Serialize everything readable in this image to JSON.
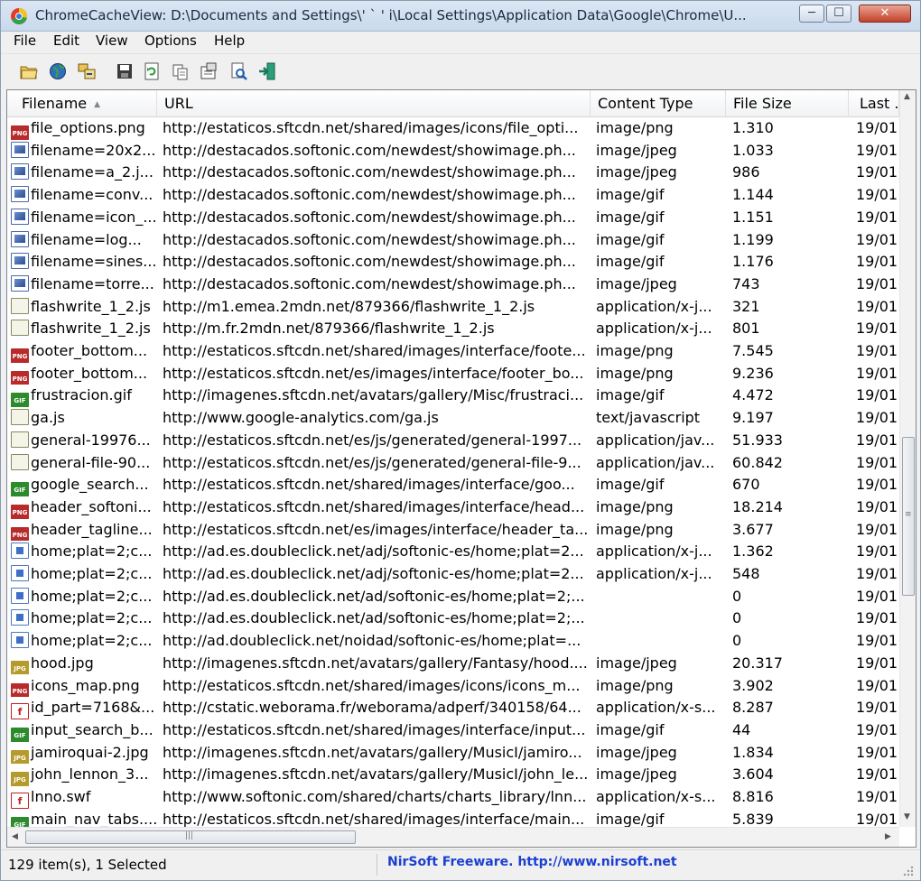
{
  "window": {
    "title": "ChromeCacheView:  D:\\Documents and Settings\\'   `  ' i\\Local Settings\\Application Data\\Google\\Chrome\\U...",
    "minimize_icon": "minimize-icon",
    "maximize_icon": "maximize-icon",
    "close_icon": "close-icon"
  },
  "menu": [
    "File",
    "Edit",
    "View",
    "Options",
    "Help"
  ],
  "toolbar": [
    {
      "name": "open-folder-icon"
    },
    {
      "name": "globe-icon"
    },
    {
      "name": "copy-files-icon"
    },
    {
      "name": "save-icon"
    },
    {
      "name": "refresh-icon"
    },
    {
      "name": "copy-icon"
    },
    {
      "name": "properties-icon"
    },
    {
      "name": "html-report-icon"
    },
    {
      "name": "exit-icon"
    }
  ],
  "columns": {
    "filename": "Filename",
    "url": "URL",
    "content_type": "Content Type",
    "file_size": "File Size",
    "last": "Last ."
  },
  "rows": [
    {
      "icon": "png",
      "filename": "file_options.png",
      "url": "http://estaticos.sftcdn.net/shared/images/icons/file_opti...",
      "type": "image/png",
      "size": "1.310",
      "last": "19/01"
    },
    {
      "icon": "img",
      "filename": "filename=20x2...",
      "url": "http://destacados.softonic.com/newdest/showimage.ph...",
      "type": "image/jpeg",
      "size": "1.033",
      "last": "19/01"
    },
    {
      "icon": "img",
      "filename": "filename=a_2.j...",
      "url": "http://destacados.softonic.com/newdest/showimage.ph...",
      "type": "image/jpeg",
      "size": "986",
      "last": "19/01"
    },
    {
      "icon": "img",
      "filename": "filename=conv...",
      "url": "http://destacados.softonic.com/newdest/showimage.ph...",
      "type": "image/gif",
      "size": "1.144",
      "last": "19/01"
    },
    {
      "icon": "img",
      "filename": "filename=icon_...",
      "url": "http://destacados.softonic.com/newdest/showimage.ph...",
      "type": "image/gif",
      "size": "1.151",
      "last": "19/01"
    },
    {
      "icon": "img",
      "filename": "filename=log...",
      "url": "http://destacados.softonic.com/newdest/showimage.ph...",
      "type": "image/gif",
      "size": "1.199",
      "last": "19/01"
    },
    {
      "icon": "img",
      "filename": "filename=sines...",
      "url": "http://destacados.softonic.com/newdest/showimage.ph...",
      "type": "image/gif",
      "size": "1.176",
      "last": "19/01"
    },
    {
      "icon": "img",
      "filename": "filename=torre...",
      "url": "http://destacados.softonic.com/newdest/showimage.ph...",
      "type": "image/jpeg",
      "size": "743",
      "last": "19/01"
    },
    {
      "icon": "js",
      "filename": "flashwrite_1_2.js",
      "url": "http://m1.emea.2mdn.net/879366/flashwrite_1_2.js",
      "type": "application/x-j...",
      "size": "321",
      "last": "19/01"
    },
    {
      "icon": "js",
      "filename": "flashwrite_1_2.js",
      "url": "http://m.fr.2mdn.net/879366/flashwrite_1_2.js",
      "type": "application/x-j...",
      "size": "801",
      "last": "19/01"
    },
    {
      "icon": "png",
      "filename": "footer_bottom...",
      "url": "http://estaticos.sftcdn.net/shared/images/interface/foote...",
      "type": "image/png",
      "size": "7.545",
      "last": "19/01"
    },
    {
      "icon": "png",
      "filename": "footer_bottom...",
      "url": "http://estaticos.sftcdn.net/es/images/interface/footer_bo...",
      "type": "image/png",
      "size": "9.236",
      "last": "19/01"
    },
    {
      "icon": "gif",
      "filename": "frustracion.gif",
      "url": "http://imagenes.sftcdn.net/avatars/gallery/Misc/frustraci...",
      "type": "image/gif",
      "size": "4.472",
      "last": "19/01"
    },
    {
      "icon": "js",
      "filename": "ga.js",
      "url": "http://www.google-analytics.com/ga.js",
      "type": "text/javascript",
      "size": "9.197",
      "last": "19/01"
    },
    {
      "icon": "js",
      "filename": "general-19976...",
      "url": "http://estaticos.sftcdn.net/es/js/generated/general-1997...",
      "type": "application/jav...",
      "size": "51.933",
      "last": "19/01"
    },
    {
      "icon": "js",
      "filename": "general-file-90...",
      "url": "http://estaticos.sftcdn.net/es/js/generated/general-file-9...",
      "type": "application/jav...",
      "size": "60.842",
      "last": "19/01"
    },
    {
      "icon": "gif",
      "filename": "google_search...",
      "url": "http://estaticos.sftcdn.net/shared/images/interface/goo...",
      "type": "image/gif",
      "size": "670",
      "last": "19/01"
    },
    {
      "icon": "png",
      "filename": "header_softoni...",
      "url": "http://estaticos.sftcdn.net/shared/images/interface/head...",
      "type": "image/png",
      "size": "18.214",
      "last": "19/01"
    },
    {
      "icon": "png",
      "filename": "header_tagline...",
      "url": "http://estaticos.sftcdn.net/es/images/interface/header_ta...",
      "type": "image/png",
      "size": "3.677",
      "last": "19/01"
    },
    {
      "icon": "doc",
      "filename": "home;plat=2;c...",
      "url": "http://ad.es.doubleclick.net/adj/softonic-es/home;plat=2...",
      "type": "application/x-j...",
      "size": "1.362",
      "last": "19/01"
    },
    {
      "icon": "doc",
      "filename": "home;plat=2;c...",
      "url": "http://ad.es.doubleclick.net/adj/softonic-es/home;plat=2...",
      "type": "application/x-j...",
      "size": "548",
      "last": "19/01"
    },
    {
      "icon": "doc",
      "filename": "home;plat=2;c...",
      "url": "http://ad.es.doubleclick.net/ad/softonic-es/home;plat=2;...",
      "type": "",
      "size": "0",
      "last": "19/01"
    },
    {
      "icon": "doc",
      "filename": "home;plat=2;c...",
      "url": "http://ad.es.doubleclick.net/ad/softonic-es/home;plat=2;...",
      "type": "",
      "size": "0",
      "last": "19/01"
    },
    {
      "icon": "doc",
      "filename": "home;plat=2;c...",
      "url": "http://ad.doubleclick.net/noidad/softonic-es/home;plat=...",
      "type": "",
      "size": "0",
      "last": "19/01"
    },
    {
      "icon": "jpg",
      "filename": "hood.jpg",
      "url": "http://imagenes.sftcdn.net/avatars/gallery/Fantasy/hood....",
      "type": "image/jpeg",
      "size": "20.317",
      "last": "19/01"
    },
    {
      "icon": "png",
      "filename": "icons_map.png",
      "url": "http://estaticos.sftcdn.net/shared/images/icons/icons_m...",
      "type": "image/png",
      "size": "3.902",
      "last": "19/01"
    },
    {
      "icon": "swf",
      "filename": "id_part=7168&...",
      "url": "http://cstatic.weborama.fr/weborama/adperf/340158/64...",
      "type": "application/x-s...",
      "size": "8.287",
      "last": "19/01"
    },
    {
      "icon": "gif",
      "filename": "input_search_b...",
      "url": "http://estaticos.sftcdn.net/shared/images/interface/input...",
      "type": "image/gif",
      "size": "44",
      "last": "19/01"
    },
    {
      "icon": "jpg",
      "filename": "jamiroquai-2.jpg",
      "url": "http://imagenes.sftcdn.net/avatars/gallery/MusicI/jamiro...",
      "type": "image/jpeg",
      "size": "1.834",
      "last": "19/01"
    },
    {
      "icon": "jpg",
      "filename": "john_lennon_3...",
      "url": "http://imagenes.sftcdn.net/avatars/gallery/MusicI/john_le...",
      "type": "image/jpeg",
      "size": "3.604",
      "last": "19/01"
    },
    {
      "icon": "swf",
      "filename": "lnno.swf",
      "url": "http://www.softonic.com/shared/charts/charts_library/lnn...",
      "type": "application/x-s...",
      "size": "8.816",
      "last": "19/01"
    },
    {
      "icon": "gif",
      "filename": "main_nav_tabs....",
      "url": "http://estaticos.sftcdn.net/shared/images/interface/main...",
      "type": "image/gif",
      "size": "5.839",
      "last": "19/01"
    }
  ],
  "icon_labels": {
    "png": "PNG",
    "gif": "GIF",
    "jpg": "JPG",
    "js": "",
    "img": "",
    "doc": "",
    "swf": "f"
  },
  "status": {
    "items": "129 item(s), 1 Selected",
    "link": "NirSoft Freeware.  http://www.nirsoft.net"
  }
}
